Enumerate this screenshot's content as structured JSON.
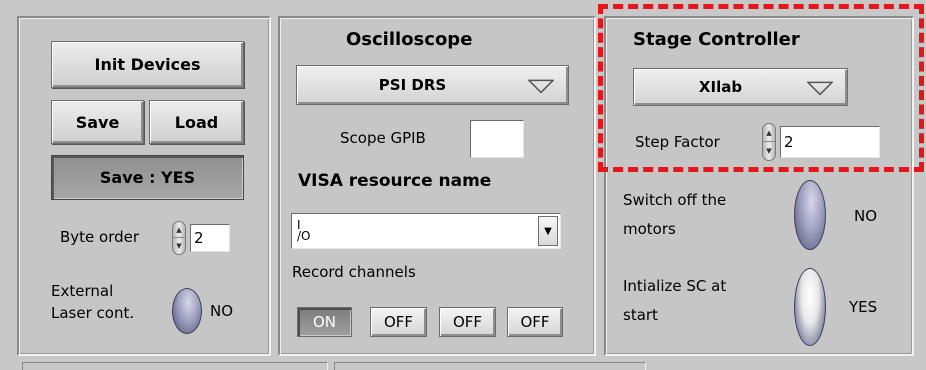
{
  "left": {
    "init_devices": "Init Devices",
    "save": "Save",
    "load": "Load",
    "save_state": "Save : YES",
    "byte_order_label": "Byte order",
    "byte_order_value": "2",
    "external_laser_label_1": "External",
    "external_laser_label_2": "Laser cont.",
    "external_laser_state": "NO"
  },
  "oscilloscope": {
    "title": "Oscilloscope",
    "device": "PSI DRS",
    "gpib_label": "Scope GPIB",
    "gpib_value": "",
    "visa_title": "VISA resource name",
    "visa_prefix": "I/O",
    "visa_value": "",
    "record_label": "Record channels",
    "channels": [
      "ON",
      "OFF",
      "OFF",
      "OFF"
    ]
  },
  "stage": {
    "title": "Stage Controller",
    "device": "XIlab",
    "step_label": "Step Factor",
    "step_value": "2",
    "motors_label_1": "Switch off the",
    "motors_label_2": "motors",
    "motors_state": "NO",
    "init_label_1": "Intialize SC at",
    "init_label_2": "start",
    "init_state": "YES"
  },
  "colors": {
    "highlight": "#e4161a",
    "panel": "#c6c6c6"
  }
}
